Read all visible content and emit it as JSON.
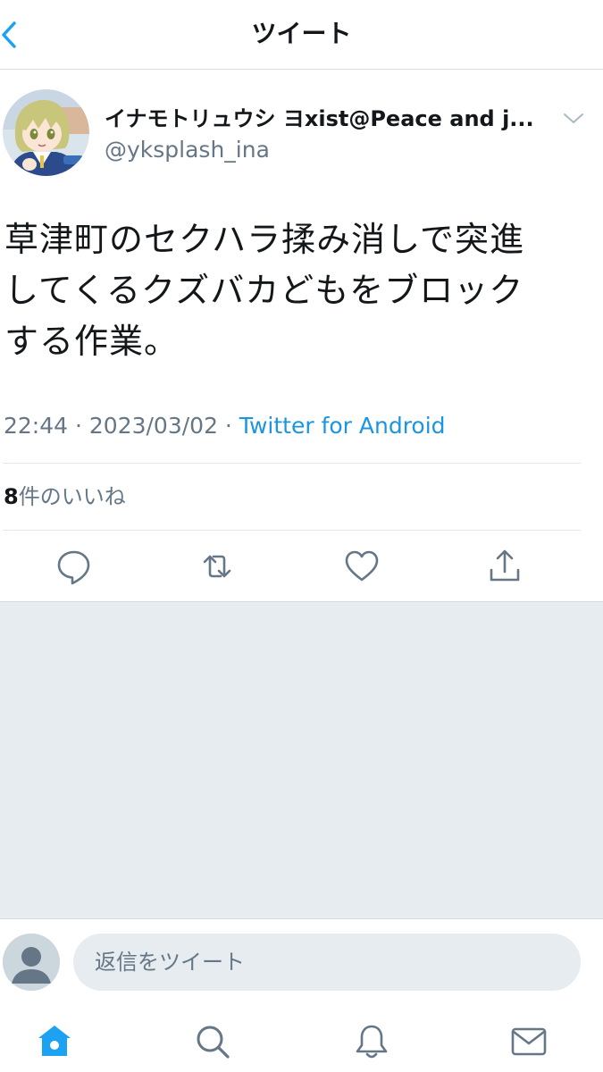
{
  "header": {
    "title": "ツイート",
    "back_icon": "chevron-left-icon"
  },
  "tweet": {
    "display_name": "イナモトリュウシ ヨxist@Peace and j...",
    "handle": "@yksplash_ina",
    "text_lines": [
      "草津町のセクハラ揉み消しで突進",
      "してくるクズバカどもをブロック",
      "する作業。"
    ],
    "time": "22:44",
    "date": "2023/03/02",
    "separator": " · ",
    "source": "Twitter for Android",
    "likes_count": "8",
    "likes_label": "件のいいね"
  },
  "actions": [
    {
      "name": "reply",
      "icon": "comment-icon"
    },
    {
      "name": "retweet",
      "icon": "retweet-icon"
    },
    {
      "name": "like",
      "icon": "heart-icon"
    },
    {
      "name": "share",
      "icon": "share-icon"
    }
  ],
  "reply": {
    "placeholder": "返信をツイート"
  },
  "nav": [
    {
      "name": "home",
      "icon": "home-icon",
      "active": true
    },
    {
      "name": "search",
      "icon": "search-icon"
    },
    {
      "name": "notifications",
      "icon": "bell-icon"
    },
    {
      "name": "messages",
      "icon": "mail-icon"
    }
  ],
  "colors": {
    "accent": "#1da1f2",
    "link": "#1b95e0",
    "text": "#14171a",
    "secondary": "#657786",
    "background_grey": "#e6ecf0",
    "divider": "#e1e8ed"
  }
}
